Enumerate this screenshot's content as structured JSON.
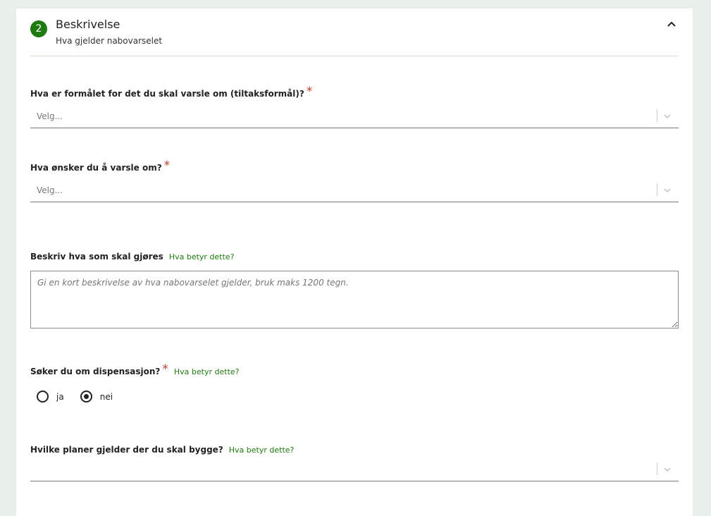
{
  "section": {
    "step_number": "2",
    "title": "Beskrivelse",
    "subtitle": "Hva gjelder nabovarselet"
  },
  "fields": {
    "purpose": {
      "label": "Hva er formålet for det du skal varsle om (tiltaksformål)?",
      "required_mark": "*",
      "placeholder": "Velg..."
    },
    "notify_about": {
      "label": "Hva ønsker du å varsle om?",
      "required_mark": "*",
      "placeholder": "Velg..."
    },
    "description": {
      "label": "Beskriv hva som skal gjøres",
      "help_link": "Hva betyr dette?",
      "placeholder": "Gi en kort beskrivelse av hva nabovarselet gjelder, bruk maks 1200 tegn."
    },
    "dispensation": {
      "label": "Søker du om dispensasjon?",
      "required_mark": "*",
      "help_link": "Hva betyr dette?",
      "options": [
        {
          "label": "ja",
          "checked": false
        },
        {
          "label": "nei",
          "checked": true
        }
      ]
    },
    "plans": {
      "label": "Hvilke planer gjelder der du skal bygge?",
      "help_link": "Hva betyr dette?",
      "placeholder": ""
    }
  },
  "colors": {
    "accent_green": "#1f7a0f",
    "required_red": "#c0392b",
    "page_background": "#e9f0ec"
  },
  "icons": {
    "collapse": "chevron-up-icon",
    "dropdown": "chevron-down-icon"
  }
}
